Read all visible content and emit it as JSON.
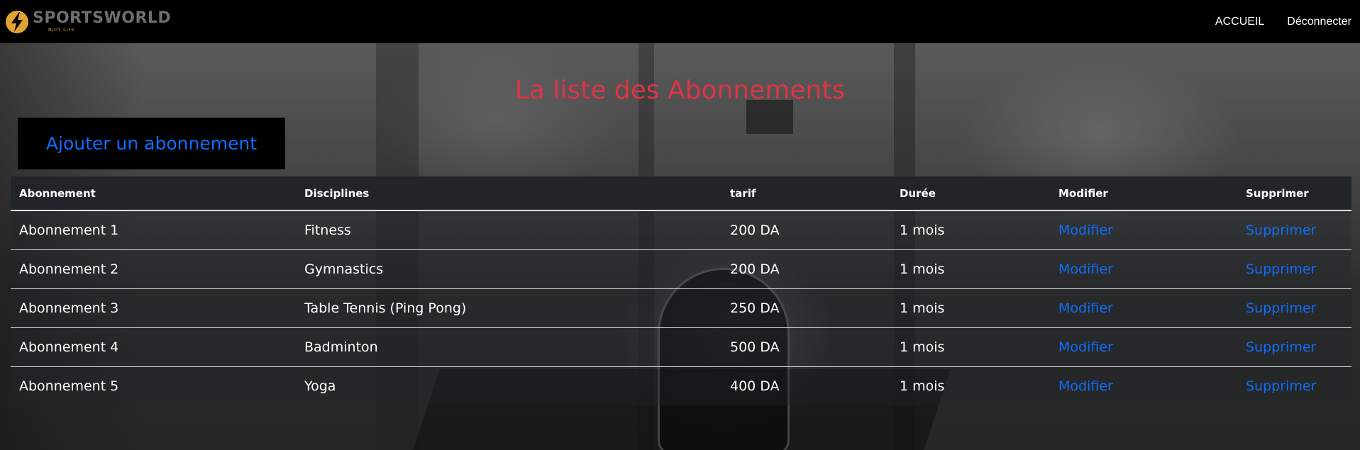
{
  "nav": {
    "brand_name": "SPORTSWORLD",
    "brand_tagline": "NJOY LIFE",
    "links": [
      "ACCUEIL",
      "Déconnecter"
    ]
  },
  "page": {
    "title": "La liste des Abonnements",
    "add_button_label": "Ajouter un abonnement"
  },
  "table": {
    "headers": [
      "Abonnement",
      "Disciplines",
      "tarif",
      "Durée",
      "Modifier",
      "Supprimer"
    ],
    "rows": [
      {
        "abonnement": "Abonnement 1",
        "discipline": "Fitness",
        "tarif": "200 DA",
        "duree": "1 mois",
        "modifier": "Modifier",
        "supprimer": "Supprimer"
      },
      {
        "abonnement": "Abonnement 2",
        "discipline": "Gymnastics",
        "tarif": "200 DA",
        "duree": "1 mois",
        "modifier": "Modifier",
        "supprimer": "Supprimer"
      },
      {
        "abonnement": "Abonnement 3",
        "discipline": "Table Tennis (Ping Pong)",
        "tarif": "250 DA",
        "duree": "1 mois",
        "modifier": "Modifier",
        "supprimer": "Supprimer"
      },
      {
        "abonnement": "Abonnement 4",
        "discipline": "Badminton",
        "tarif": "500 DA",
        "duree": "1 mois",
        "modifier": "Modifier",
        "supprimer": "Supprimer"
      },
      {
        "abonnement": "Abonnement 5",
        "discipline": "Yoga",
        "tarif": "400 DA",
        "duree": "1 mois",
        "modifier": "Modifier",
        "supprimer": "Supprimer"
      }
    ]
  },
  "colors": {
    "title": "#dc3545",
    "link": "#0d6efd",
    "navbar": "#000000",
    "logo_accent": "#e0a330"
  },
  "icons": {
    "logo": "lightning-bolt-circle-icon"
  }
}
